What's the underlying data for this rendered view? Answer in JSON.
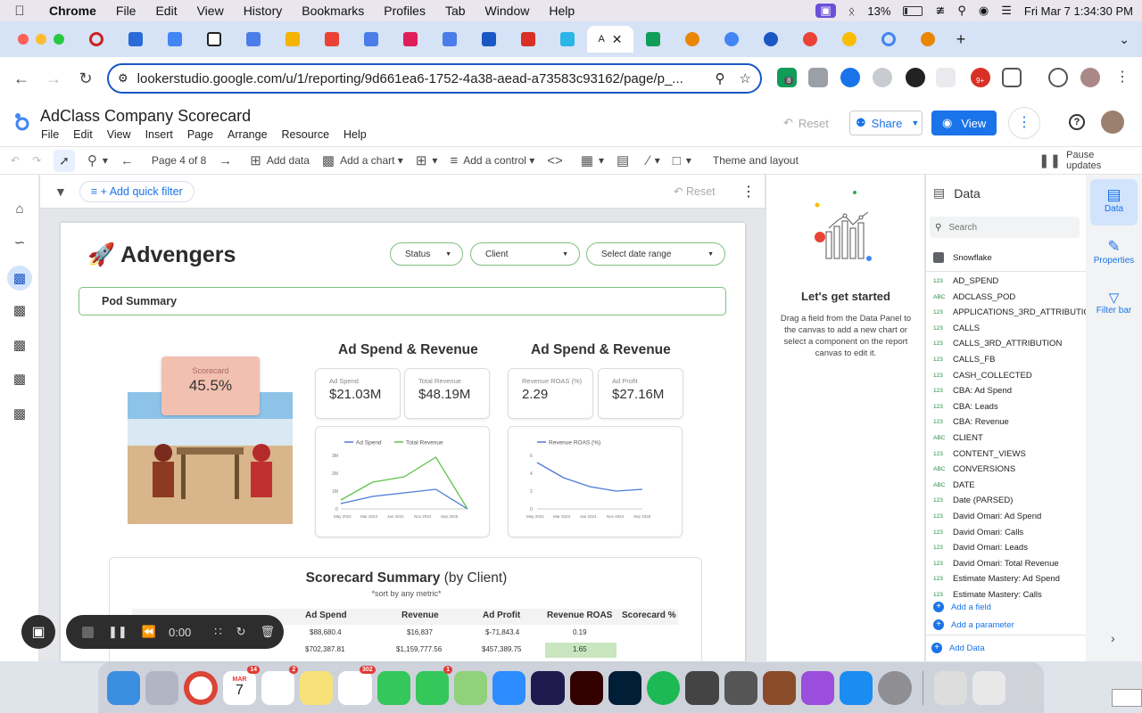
{
  "macos": {
    "menu": [
      "Chrome",
      "File",
      "Edit",
      "View",
      "History",
      "Bookmarks",
      "Profiles",
      "Tab",
      "Window",
      "Help"
    ],
    "battery": "13%",
    "clock": "Fri Mar 7  1:34:30 PM"
  },
  "browser": {
    "url": "lookerstudio.google.com/u/1/reporting/9d661ea6-1752-4a38-aead-a73583c93162/page/p_...",
    "active_tab_label": "A",
    "ext_badge_1": "8",
    "ext_badge_2": "9+"
  },
  "report": {
    "title": "AdClass Company Scorecard",
    "menu": [
      "File",
      "Edit",
      "View",
      "Insert",
      "Page",
      "Arrange",
      "Resource",
      "Help"
    ],
    "reset": "Reset",
    "share": "Share",
    "view": "View",
    "toolbar": {
      "page_indicator": "Page 4 of 8",
      "add_data": "Add data",
      "add_chart": "Add a chart",
      "add_control": "Add a control",
      "theme": "Theme and layout",
      "pause": "Pause updates"
    },
    "filter": {
      "add_quick_filter": "+ Add quick filter",
      "reset": "Reset"
    }
  },
  "canvas": {
    "brand": "Advengers",
    "controls": [
      "Status",
      "Client",
      "Select date range"
    ],
    "pod_summary": "Pod Summary",
    "scorecard": {
      "label": "Scorecard",
      "value": "45.5%"
    },
    "section1_title": "Ad Spend & Revenue",
    "section2_title": "Ad Spend & Revenue",
    "kpis": [
      {
        "label": "Ad Spend",
        "value": "$21.03M"
      },
      {
        "label": "Total Revenue",
        "value": "$48.19M"
      },
      {
        "label": "Revenue ROAS (%)",
        "value": "2.29"
      },
      {
        "label": "Ad Profit",
        "value": "$27.16M"
      }
    ],
    "chart1": {
      "legend": [
        "Ad Spend",
        "Total Revenue"
      ],
      "yticks": [
        "3M",
        "2M",
        "1M",
        "0"
      ],
      "xticks": [
        "May 2022",
        "Mar 2023",
        "Jan 2024",
        "Nov 2024",
        "Sep 2025"
      ]
    },
    "chart2": {
      "legend": [
        "Revenue ROAS (%)"
      ],
      "yticks": [
        "6",
        "4",
        "2",
        "0"
      ],
      "xticks": [
        "May 2022",
        "Mar 2023",
        "Jan 2024",
        "Nov 2024",
        "Sep 2025"
      ]
    },
    "summary": {
      "title": "Scorecard Summary",
      "title_suffix": "(by Client)",
      "subtitle": "*sort by any metric*",
      "headers": [
        "Ad Spend",
        "Revenue",
        "Ad Profit",
        "Revenue ROAS",
        "Scorecard %"
      ],
      "rows": [
        [
          "$88,680.4",
          "$16,837",
          "$-71,843.4",
          "0.19",
          ""
        ],
        [
          "$702,387.81",
          "$1,159,777.56",
          "$457,389.75",
          "1.65",
          ""
        ]
      ]
    }
  },
  "chart_data": [
    {
      "type": "line",
      "x": [
        "May 2022",
        "Mar 2023",
        "Jan 2024",
        "Nov 2024",
        "Sep 2025"
      ],
      "ylim": [
        0,
        3000000
      ],
      "series": [
        {
          "name": "Ad Spend",
          "values": [
            300000,
            700000,
            900000,
            1100000,
            0
          ]
        },
        {
          "name": "Total Revenue",
          "values": [
            500000,
            1500000,
            1800000,
            2900000,
            0
          ]
        }
      ]
    },
    {
      "type": "line",
      "x": [
        "May 2022",
        "Mar 2023",
        "Jan 2024",
        "Nov 2024",
        "Sep 2025"
      ],
      "ylim": [
        0,
        6
      ],
      "series": [
        {
          "name": "Revenue ROAS (%)",
          "values": [
            5.2,
            3.5,
            2.5,
            2.0,
            2.2
          ]
        }
      ]
    }
  ],
  "player": {
    "time": "0:00"
  },
  "properties": {
    "heading": "Let's get started",
    "body": "Drag a field from the Data Panel to the canvas to add a new chart or select a component on the report canvas to edit it."
  },
  "data_panel": {
    "title": "Data",
    "search_placeholder": "Search",
    "source": "Snowflake",
    "fields": [
      {
        "type": "123",
        "name": "AD_SPEND"
      },
      {
        "type": "ABC",
        "name": "ADCLASS_POD"
      },
      {
        "type": "123",
        "name": "APPLICATIONS_3RD_ATTRIBUTION"
      },
      {
        "type": "123",
        "name": "CALLS"
      },
      {
        "type": "123",
        "name": "CALLS_3RD_ATTRIBUTION"
      },
      {
        "type": "123",
        "name": "CALLS_FB"
      },
      {
        "type": "123",
        "name": "CASH_COLLECTED"
      },
      {
        "type": "123",
        "name": "CBA: Ad Spend"
      },
      {
        "type": "123",
        "name": "CBA: Leads"
      },
      {
        "type": "123",
        "name": "CBA: Revenue"
      },
      {
        "type": "ABC",
        "name": "CLIENT"
      },
      {
        "type": "123",
        "name": "CONTENT_VIEWS"
      },
      {
        "type": "ABC",
        "name": "CONVERSIONS"
      },
      {
        "type": "ABC",
        "name": "DATE"
      },
      {
        "type": "123",
        "name": "Date (PARSED)"
      },
      {
        "type": "123",
        "name": "David Omari: Ad Spend"
      },
      {
        "type": "123",
        "name": "David Omari: Calls"
      },
      {
        "type": "123",
        "name": "David Omari: Leads"
      },
      {
        "type": "123",
        "name": "David Omari: Total Revenue"
      },
      {
        "type": "123",
        "name": "Estimate Mastery: Ad Spend"
      },
      {
        "type": "123",
        "name": "Estimate Mastery: Calls"
      }
    ],
    "add_field": "Add a field",
    "add_parameter": "Add a parameter",
    "add_data": "Add Data"
  },
  "side_rail": [
    "Data",
    "Properties",
    "Filter bar"
  ],
  "dock": {
    "calendar_month": "MAR",
    "calendar_day": "7",
    "badges": [
      "14",
      "2",
      "302",
      "1"
    ]
  },
  "colors": {
    "accent": "#1a73e8",
    "green": "#7fbf7f",
    "ad_spend": "#4a7bd8",
    "revenue": "#5fc24a"
  }
}
